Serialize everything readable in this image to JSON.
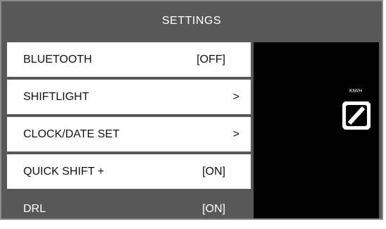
{
  "header": {
    "title": "SETTINGS"
  },
  "menu": {
    "items": [
      {
        "label": "BLUETOOTH",
        "value": "[OFF]",
        "chevron": ""
      },
      {
        "label": "SHIFTLIGHT",
        "value": "",
        "chevron": ">"
      },
      {
        "label": "CLOCK/DATE SET",
        "value": "",
        "chevron": ">"
      },
      {
        "label": "QUICK SHIFT +",
        "value": "[ON]",
        "chevron": ""
      },
      {
        "label": "DRL",
        "value": "[ON]",
        "chevron": ""
      }
    ],
    "selected_index": 4
  },
  "display": {
    "unit": "KM/H",
    "icon": "speed-zero-slash-icon"
  },
  "colors": {
    "background": "#585858",
    "row": "#ffffff",
    "display": "#000000",
    "text": "#111111",
    "text_active": "#ffffff"
  }
}
